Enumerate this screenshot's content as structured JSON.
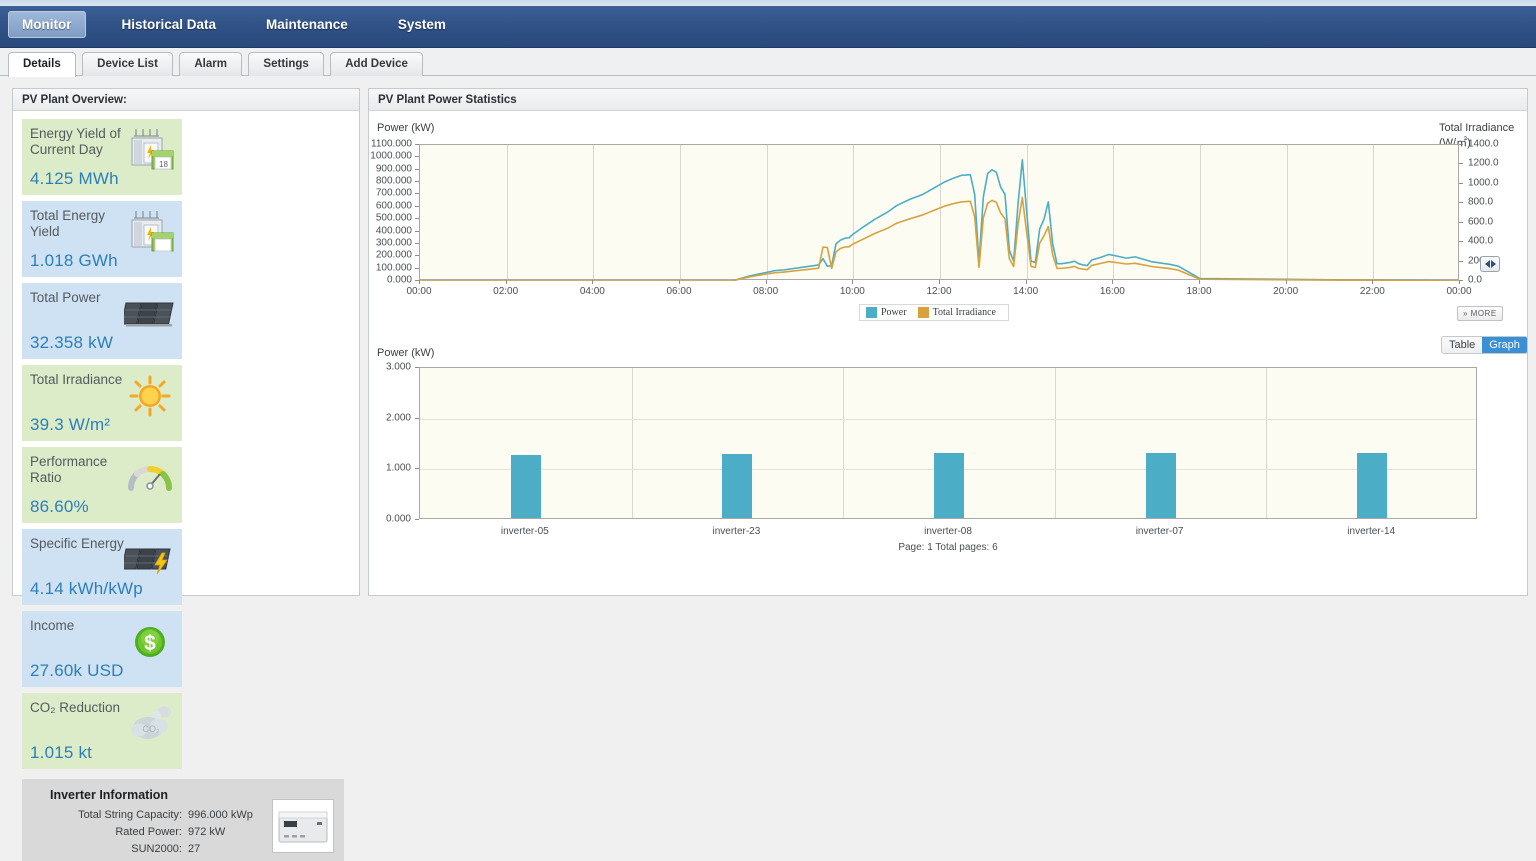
{
  "nav": {
    "items": [
      {
        "label": "Monitor",
        "active": true
      },
      {
        "label": "Historical Data",
        "active": false
      },
      {
        "label": "Maintenance",
        "active": false
      },
      {
        "label": "System",
        "active": false
      }
    ]
  },
  "subtabs": {
    "items": [
      {
        "label": "Details",
        "active": true
      },
      {
        "label": "Device List",
        "active": false
      },
      {
        "label": "Alarm",
        "active": false
      },
      {
        "label": "Settings",
        "active": false
      },
      {
        "label": "Add Device",
        "active": false
      }
    ]
  },
  "left_panel": {
    "title": "PV Plant Overview:",
    "cards": [
      {
        "label": "Energy Yield of Current Day",
        "value": "4.125 MWh",
        "tone": "green",
        "icon": "substation-calendar-icon"
      },
      {
        "label": "Total Energy Yield",
        "value": "1.018 GWh",
        "tone": "blue",
        "icon": "substation-icon"
      },
      {
        "label": "Total Power",
        "value": "32.358 kW",
        "tone": "blue",
        "icon": "solar-panel-icon"
      },
      {
        "label": "Total Irradiance",
        "value": "39.3 W/m²",
        "tone": "green",
        "icon": "sun-icon"
      },
      {
        "label": "Performance Ratio",
        "value": "86.60%",
        "tone": "green",
        "icon": "gauge-icon"
      },
      {
        "label": "Specific Energy",
        "value": "4.14 kWh/kWp",
        "tone": "blue",
        "icon": "solar-panel-bolt-icon"
      },
      {
        "label": "Income",
        "value": "27.60k USD",
        "tone": "blue",
        "icon": "dollar-coin-icon"
      },
      {
        "label": "CO₂ Reduction",
        "value": "1.015 kt",
        "tone": "green",
        "icon": "co2-cloud-icon"
      }
    ],
    "inverter": {
      "title": "Inverter Information",
      "rows": [
        {
          "key": "Total String Capacity:",
          "value": "996.000 kWp"
        },
        {
          "key": "Rated Power:",
          "value": "972 kW"
        },
        {
          "key": "SUN2000:",
          "value": "27"
        }
      ],
      "image_alt": "inverter-photo"
    }
  },
  "right_panel": {
    "title": "PV Plant Power Statistics",
    "more_button": "» MORE",
    "view_toggle": {
      "table": "Table",
      "graph": "Graph",
      "active": "Graph"
    },
    "page_info": "Page: 1   Total pages: 6"
  },
  "colors": {
    "power": "#4cadc7",
    "irradiance": "#d9a13b",
    "accent": "#3b8fd4",
    "nav_bg": "#2f5185",
    "card_green": "#dcecc8",
    "card_blue": "#cfe2f3",
    "plot_bg": "#fdfcf2"
  },
  "chart_data": [
    {
      "type": "line",
      "title": "PV Plant Power Statistics",
      "ylabel": "Power (kW)",
      "y2label": "Total Irradiance  (W/㎡)",
      "xlabel": "",
      "ylim": [
        0,
        1100
      ],
      "y2lim": [
        0,
        1400
      ],
      "yticks": [
        "0.000",
        "100.000",
        "200.000",
        "300.000",
        "400.000",
        "500.000",
        "600.000",
        "700.000",
        "800.000",
        "900.000",
        "1000.000",
        "1100.000"
      ],
      "y2ticks": [
        "0.0",
        "200.0",
        "400.0",
        "600.0",
        "800.0",
        "1000.0",
        "1200.0",
        "1400.0"
      ],
      "xticks": [
        "00:00",
        "02:00",
        "04:00",
        "06:00",
        "08:00",
        "10:00",
        "12:00",
        "14:00",
        "16:00",
        "18:00",
        "20:00",
        "22:00",
        "00:00"
      ],
      "grid": true,
      "legend": [
        {
          "name": "Power",
          "color": "#4cadc7"
        },
        {
          "name": "Total Irradiance",
          "color": "#d9a13b"
        }
      ],
      "legend_position": "bottom-center",
      "x": [
        0.0,
        7.2,
        7.4,
        7.6,
        7.8,
        8.0,
        8.2,
        8.4,
        8.6,
        8.8,
        9.0,
        9.2,
        9.3,
        9.4,
        9.5,
        9.6,
        9.7,
        9.8,
        9.9,
        10.0,
        10.2,
        10.5,
        10.8,
        11.0,
        11.3,
        11.6,
        11.9,
        12.1,
        12.3,
        12.5,
        12.7,
        12.8,
        12.9,
        13.0,
        13.1,
        13.2,
        13.3,
        13.4,
        13.5,
        13.6,
        13.7,
        13.8,
        13.9,
        14.0,
        14.1,
        14.2,
        14.3,
        14.4,
        14.5,
        14.6,
        14.7,
        14.8,
        14.9,
        15.0,
        15.1,
        15.2,
        15.3,
        15.4,
        15.5,
        15.7,
        15.9,
        16.1,
        16.3,
        16.5,
        16.7,
        16.9,
        17.1,
        17.3,
        17.5,
        17.8,
        18.0,
        24.0
      ],
      "series": [
        {
          "name": "Power",
          "color": "#4cadc7",
          "values": [
            0,
            0,
            20,
            40,
            55,
            70,
            85,
            90,
            100,
            110,
            120,
            130,
            180,
            120,
            125,
            300,
            330,
            345,
            350,
            380,
            430,
            500,
            560,
            610,
            660,
            700,
            760,
            800,
            830,
            855,
            860,
            700,
            150,
            680,
            870,
            900,
            880,
            760,
            700,
            250,
            160,
            620,
            980,
            560,
            160,
            150,
            420,
            500,
            640,
            300,
            140,
            140,
            145,
            150,
            160,
            140,
            130,
            125,
            170,
            190,
            215,
            200,
            185,
            195,
            175,
            155,
            145,
            135,
            120,
            60,
            20,
            0
          ]
        },
        {
          "name": "Total Irradiance",
          "color": "#d9a13b",
          "values": [
            0,
            0,
            22,
            42,
            58,
            72,
            86,
            92,
            102,
            112,
            122,
            132,
            350,
            345,
            130,
            300,
            335,
            350,
            352,
            382,
            425,
            490,
            545,
            595,
            640,
            680,
            735,
            770,
            795,
            815,
            820,
            660,
            140,
            650,
            800,
            830,
            810,
            700,
            640,
            230,
            150,
            580,
            860,
            500,
            150,
            140,
            390,
            465,
            560,
            270,
            130,
            130,
            135,
            140,
            150,
            130,
            122,
            118,
            160,
            180,
            200,
            188,
            175,
            182,
            165,
            148,
            138,
            128,
            112,
            55,
            18,
            0
          ]
        }
      ]
    },
    {
      "type": "bar",
      "ylabel": "Power (kW)",
      "ylim": [
        0,
        3
      ],
      "yticks": [
        "0.000",
        "1.000",
        "2.000",
        "3.000"
      ],
      "categories": [
        "inverter-05",
        "inverter-23",
        "inverter-08",
        "inverter-07",
        "inverter-14"
      ],
      "values": [
        1.25,
        1.27,
        1.28,
        1.28,
        1.28
      ],
      "series": [
        {
          "name": "Power",
          "color": "#4cadc7",
          "values": [
            1.25,
            1.27,
            1.28,
            1.28,
            1.28
          ]
        }
      ],
      "grid": true,
      "legend_position": "none"
    }
  ]
}
